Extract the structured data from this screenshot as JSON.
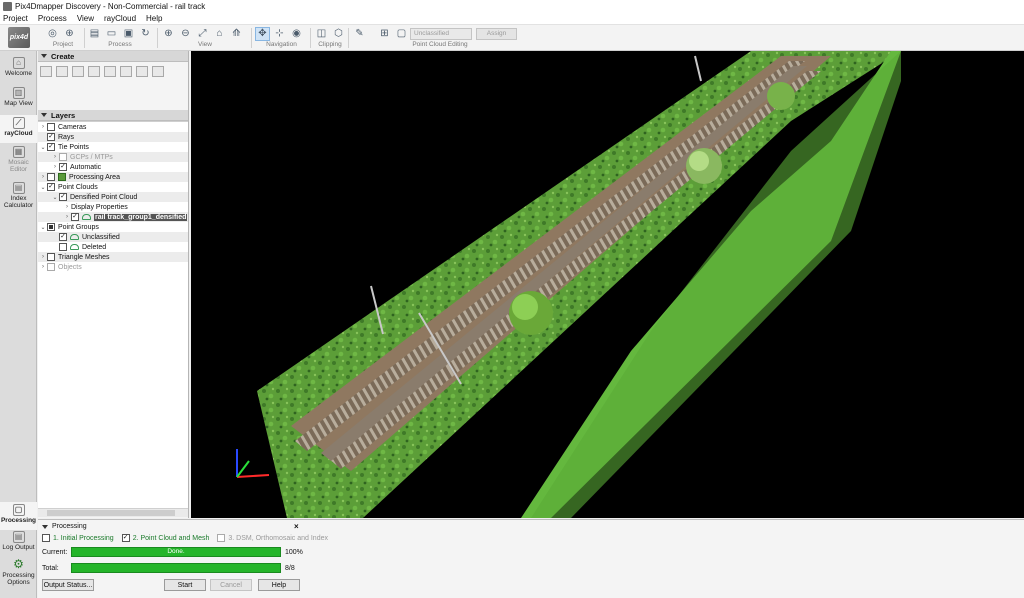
{
  "window": {
    "title": "Pix4Dmapper Discovery - Non-Commercial - rail track"
  },
  "menu": [
    "Project",
    "Process",
    "View",
    "rayCloud",
    "Help"
  ],
  "toolbar": {
    "logo_text": "pix4d",
    "groups": {
      "project": "Project",
      "process": "Process",
      "view": "View",
      "navigation": "Navigation",
      "clipping": "Clipping",
      "editing": "Point Cloud Editing"
    },
    "class_combo": "Unclassified",
    "assign_label": "Assign"
  },
  "left_nav": [
    {
      "label": "Welcome"
    },
    {
      "label": "Map View"
    },
    {
      "label": "rayCloud"
    },
    {
      "label": "Mosaic Editor"
    },
    {
      "label": "Index Calculator"
    },
    {
      "label": "Processing"
    },
    {
      "label": "Log Output"
    },
    {
      "label": "Processing Options"
    }
  ],
  "panel": {
    "create_title": "Create",
    "layers_title": "Layers",
    "layers": [
      {
        "label": "Cameras",
        "checked": "no"
      },
      {
        "label": "Rays",
        "checked": "yes"
      },
      {
        "label": "Tie Points",
        "checked": "yes"
      },
      {
        "label": "GCPs / MTPs",
        "checked": "disabled"
      },
      {
        "label": "Automatic",
        "checked": "yes"
      },
      {
        "label": "Processing Area",
        "checked": "no"
      },
      {
        "label": "Point Clouds",
        "checked": "yes"
      },
      {
        "label": "Densified Point Cloud",
        "checked": "yes"
      },
      {
        "label": "Display Properties"
      },
      {
        "label": "rail track_group1_densified",
        "checked": "yes"
      },
      {
        "label": "Point Groups",
        "checked": "partial"
      },
      {
        "label": "Unclassified",
        "checked": "yes"
      },
      {
        "label": "Deleted",
        "checked": "no"
      },
      {
        "label": "Triangle Meshes",
        "checked": "no"
      },
      {
        "label": "Objects",
        "checked": "disabled"
      }
    ]
  },
  "processing": {
    "title": "Processing",
    "close": "×",
    "steps": [
      "1. Initial Processing",
      "2. Point Cloud and Mesh",
      "3. DSM, Orthomosaic and Index"
    ],
    "current_label": "Current:",
    "current_text": "Done.",
    "current_value": "100%",
    "current_progress": 1.0,
    "total_label": "Total:",
    "total_value": "8/8",
    "total_progress": 1.0,
    "buttons": {
      "output_status": "Output Status...",
      "start": "Start",
      "cancel": "Cancel",
      "help": "Help"
    }
  },
  "colors": {
    "progress": "#25b52a",
    "viewport_bg": "#000000",
    "grass": "#5ea63b",
    "track_bed": "#8f7860"
  }
}
